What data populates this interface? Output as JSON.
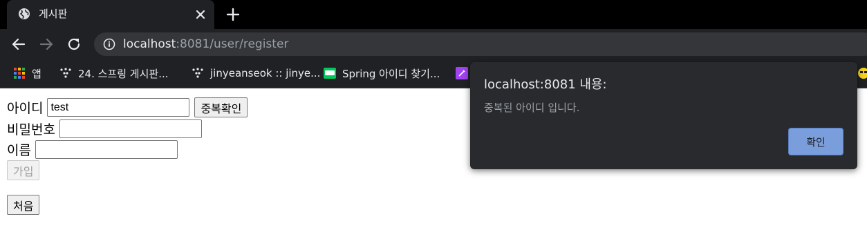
{
  "browser": {
    "tab": {
      "title": "게시판",
      "favicon": "globe-icon"
    },
    "address": {
      "host": "localhost",
      "rest": ":8081/user/register"
    },
    "bookmarks": [
      {
        "label": "앱",
        "icon": "apps-grid-icon"
      },
      {
        "label": "24. 스프링 게시판...",
        "icon": "dots-logo-icon"
      },
      {
        "label": "jinyeanseok :: jinye...",
        "icon": "dots-logo-icon"
      },
      {
        "label": "Spring 아이디 찾기...",
        "icon": "blog-logo-icon"
      }
    ]
  },
  "form": {
    "id_label": "아이디",
    "id_value": "test",
    "dup_check_button": "중복확인",
    "password_label": "비밀번호",
    "password_value": "",
    "name_label": "이름",
    "name_value": "",
    "join_button": "가입",
    "home_button": "처음"
  },
  "dialog": {
    "title": "localhost:8081 내용:",
    "message": "중복된 아이디 입니다.",
    "ok_button": "확인"
  },
  "colors": {
    "chrome_bg": "#202124",
    "dialog_bg": "#292a2d",
    "dialog_ok": "#7a9edc"
  }
}
